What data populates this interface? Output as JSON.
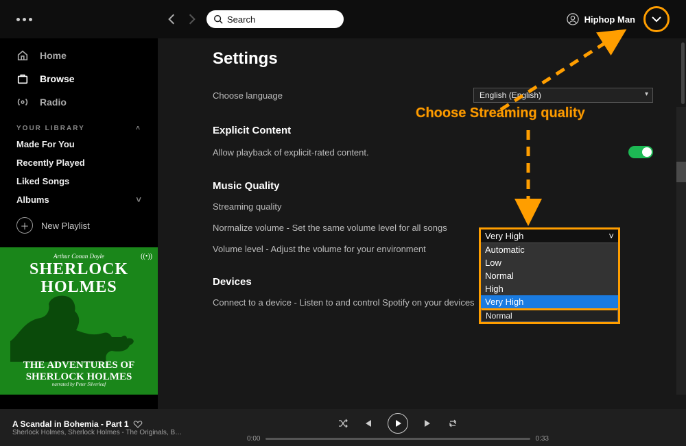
{
  "topbar": {
    "search_placeholder": "Search",
    "user_name": "Hiphop Man"
  },
  "sidebar": {
    "nav": [
      {
        "label": "Home"
      },
      {
        "label": "Browse"
      },
      {
        "label": "Radio"
      }
    ],
    "section": "YOUR LIBRARY",
    "lib": [
      {
        "label": "Made For You"
      },
      {
        "label": "Recently Played"
      },
      {
        "label": "Liked Songs"
      },
      {
        "label": "Albums"
      }
    ],
    "new_playlist": "New Playlist"
  },
  "cover": {
    "author": "Arthur Conan Doyle",
    "title_a": "SHERLOCK",
    "title_b": "HOLMES",
    "audio_icon_name": "broadcast-icon",
    "adv_a": "THE ADVENTURES OF",
    "adv_b": "SHERLOCK HOLMES",
    "narr": "narrated by Peter Silverleaf"
  },
  "settings": {
    "title": "Settings",
    "language_label": "Choose language",
    "language_value": "English (English)",
    "explicit_header": "Explicit Content",
    "explicit_text": "Allow playback of explicit-rated content.",
    "quality_header": "Music Quality",
    "streaming_label": "Streaming quality",
    "streaming_selected": "Very High",
    "streaming_options": [
      "Automatic",
      "Low",
      "Normal",
      "High",
      "Very High"
    ],
    "normalize_text": "Normalize volume - Set the same volume level for all songs",
    "vol_text": "Volume level - Adjust the volume for your environment",
    "devices_header": "Devices",
    "devices_text": "Connect to a device - Listen to and control Spotify on your devices",
    "under_select": "Normal"
  },
  "player": {
    "track_title": "A Scandal in Bohemia - Part 1",
    "track_sub": "Sherlock Holmes, Sherlock Holmes - The Originals, B…",
    "time_cur": "0:00",
    "time_tot": "0:33"
  },
  "annotation": {
    "text": "Choose Streaming quality"
  }
}
